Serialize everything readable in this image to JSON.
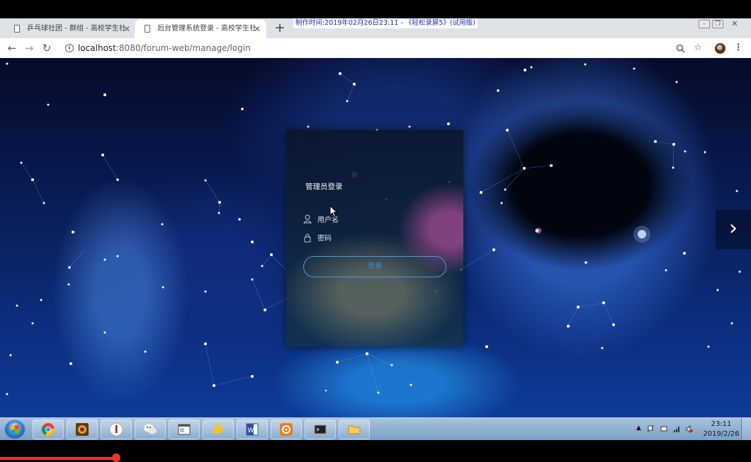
{
  "browser": {
    "tabs": [
      {
        "title": "乒乓球社团 - 群组 - 高校学生社团",
        "active": false
      },
      {
        "title": "后台管理系统登录 - 高校学生社团",
        "active": true
      }
    ],
    "new_tab_label": "+",
    "url_host": "localhost",
    "url_rest": ":8080/forum-web/manage/login",
    "nav_icons": [
      "back-icon",
      "forward-icon",
      "reload-icon"
    ],
    "address_icons": [
      "zoom-icon",
      "star-icon",
      "profile-avatar",
      "menu-icon"
    ]
  },
  "watermark": "制作时间:2019年02月26日23:11 - 《轻松录屏5》(试用版)",
  "login": {
    "title": "管理员登录",
    "username_placeholder": "用户名",
    "password_placeholder": "密码",
    "submit_label": "登录"
  },
  "carousel_next": "›",
  "taskbar": {
    "apps": [
      "chrome-icon",
      "game-icon",
      "wine-icon",
      "wechat-icon",
      "window-icon",
      "pinyin-icon",
      "word-icon",
      "settings-icon",
      "terminal-icon",
      "folder-icon"
    ],
    "clock_time": "23:11",
    "clock_date": "2019/2/26"
  },
  "colors": {
    "accent_button": "#4a9ad8",
    "watermark_text": "#1a2bb8",
    "recording_bar": "#e23a2e"
  }
}
